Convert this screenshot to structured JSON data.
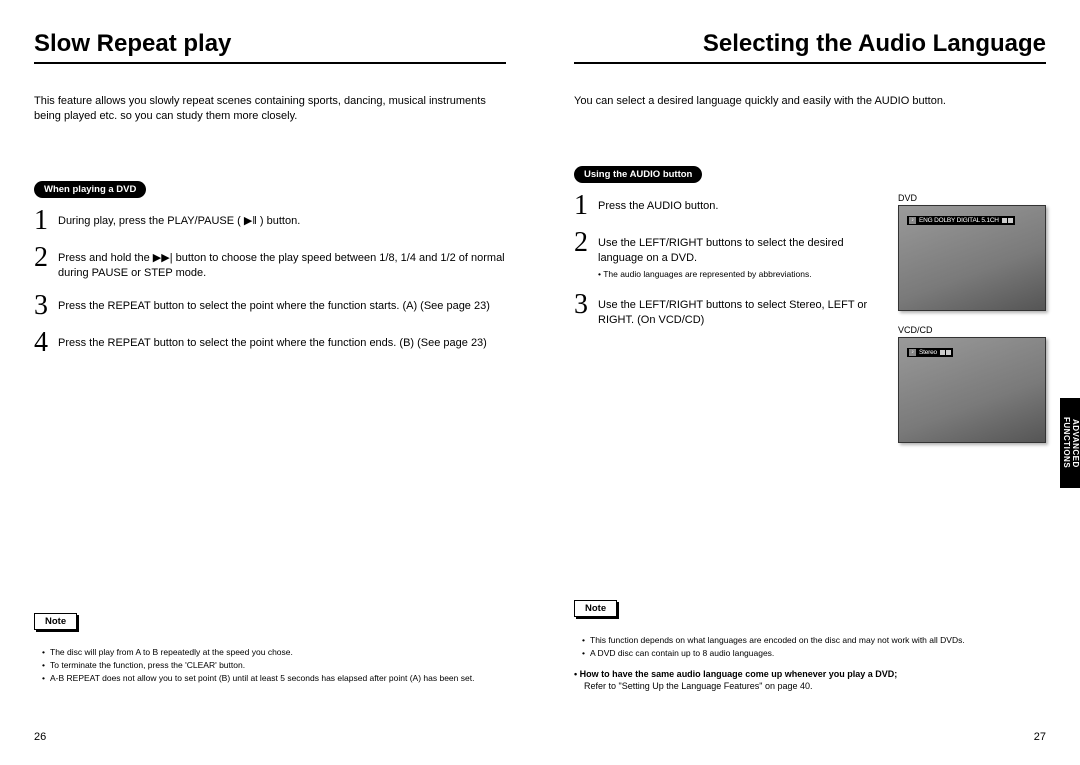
{
  "left": {
    "title": "Slow Repeat play",
    "intro": "This feature allows you slowly repeat scenes containing sports, dancing, musical instruments being played etc. so you can study them more closely.",
    "chip": "When playing a DVD",
    "steps": [
      "During play, press the PLAY/PAUSE ( ▶‖ ) button.",
      "Press and hold the ▶▶| button to choose the play speed between 1/8, 1/4 and 1/2 of normal during PAUSE or STEP mode.",
      "Press the REPEAT button to select the point where the function starts. (A) (See page 23)",
      "Press the REPEAT button to select the point where the function ends. (B) (See page 23)"
    ],
    "note_label": "Note",
    "notes": [
      "The disc will play from A to B repeatedly at the speed you chose.",
      "To terminate the function, press the 'CLEAR' button.",
      "A-B REPEAT does not allow you to set point (B) until at least 5 seconds has elapsed after point (A) has been set."
    ],
    "page_num": "26"
  },
  "right": {
    "title": "Selecting the Audio Language",
    "intro": "You can select a desired language quickly and easily with the AUDIO button.",
    "chip": "Using the AUDIO button",
    "steps": [
      {
        "text": "Press the AUDIO button."
      },
      {
        "text": "Use the LEFT/RIGHT buttons to select the desired language on a DVD.",
        "sub": "The audio languages are represented by abbreviations."
      },
      {
        "text": "Use the LEFT/RIGHT buttons to select Stereo, LEFT or RIGHT. (On VCD/CD)"
      }
    ],
    "tv1_label": "DVD",
    "tv1_osd": "ENG DOLBY DIGITAL 5.1CH",
    "tv2_label": "VCD/CD",
    "tv2_osd": "Stereo",
    "note_label": "Note",
    "notes": [
      "This function depends on what languages are encoded on the disc and may not work with all DVDs.",
      "A DVD disc can contain up to 8 audio languages."
    ],
    "howto": "How to have the same audio language come up whenever you play a DVD;",
    "howto_sub": "Refer to \"Setting Up the Language Features\" on page 40.",
    "page_num": "27",
    "side_tab": "ADVANCED FUNCTIONS"
  }
}
